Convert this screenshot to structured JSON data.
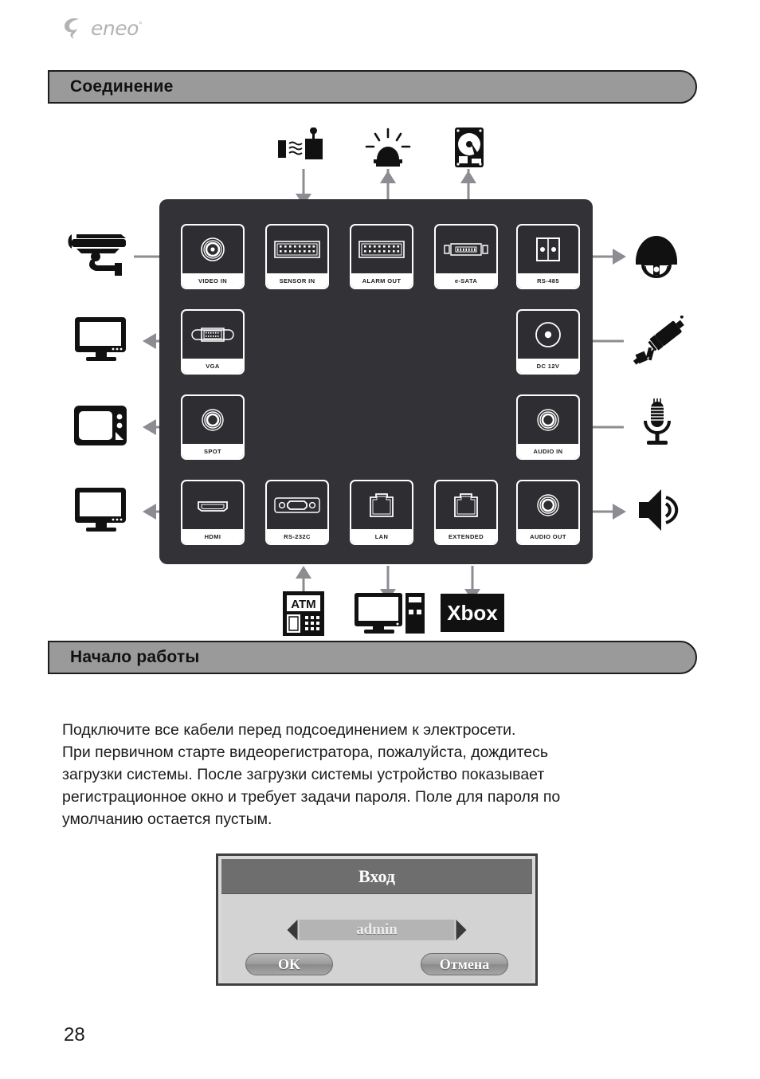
{
  "brand": {
    "name": "eneo",
    "trademark": "°",
    "logo_icon": "eneo-swirl-logo"
  },
  "sections": {
    "connection": {
      "title": "Соединение"
    },
    "getting_started": {
      "title": "Начало работы"
    }
  },
  "diagram": {
    "ports": {
      "video_in": {
        "label": "VIDEO IN",
        "icon": "bnc-connector-icon"
      },
      "sensor_in": {
        "label": "SENSOR IN",
        "icon": "terminal-block-icon"
      },
      "alarm_out": {
        "label": "ALARM OUT",
        "icon": "terminal-block-icon"
      },
      "esata": {
        "label": "e-SATA",
        "icon": "esata-connector-icon"
      },
      "rs485": {
        "label": "RS-485",
        "icon": "rs485-terminal-icon"
      },
      "vga": {
        "label": "VGA",
        "icon": "vga-connector-icon"
      },
      "dc12v": {
        "label": "DC 12V",
        "icon": "dc-jack-icon"
      },
      "spot": {
        "label": "SPOT",
        "icon": "rca-jack-icon"
      },
      "audio_in": {
        "label": "AUDIO IN",
        "icon": "rca-jack-icon"
      },
      "hdmi": {
        "label": "HDMI",
        "icon": "hdmi-connector-icon"
      },
      "rs232c": {
        "label": "RS-232C",
        "icon": "db9-connector-icon"
      },
      "lan": {
        "label": "LAN",
        "icon": "rj45-connector-icon"
      },
      "extended": {
        "label": "EXTENDED",
        "icon": "rj45-connector-icon"
      },
      "audio_out": {
        "label": "AUDIO OUT",
        "icon": "rca-jack-icon"
      }
    },
    "devices": {
      "camera": {
        "icon": "cctv-bullet-camera-icon"
      },
      "sensor": {
        "icon": "motion-sensor-icon"
      },
      "siren": {
        "icon": "alarm-siren-icon"
      },
      "hdd": {
        "icon": "hard-disk-drive-icon"
      },
      "ptz": {
        "icon": "ptz-dome-camera-icon"
      },
      "monitor_vga": {
        "icon": "lcd-monitor-icon"
      },
      "power_adapter": {
        "icon": "power-adapter-plug-icon"
      },
      "spot_monitor": {
        "icon": "crt-monitor-icon"
      },
      "microphone": {
        "icon": "microphone-icon"
      },
      "monitor_hdmi": {
        "icon": "lcd-monitor-icon"
      },
      "speaker": {
        "icon": "speaker-icon"
      },
      "atm": {
        "icon": "atm-machine-icon",
        "label": "ATM"
      },
      "pc": {
        "icon": "desktop-computer-icon"
      },
      "xbox": {
        "icon": "xbox-console-icon",
        "label": "Xbox"
      }
    }
  },
  "instructions": {
    "line1": "Подключите все кабели перед подсоединением к электросети.",
    "line2": "При первичном старте видеорегистратора, пожалуйста, дождитесь",
    "line3": "загрузки системы. После загрузки системы устройство показывает",
    "line4": "регистрационное окно и требует задачи пароля. Поле для пароля по",
    "line5": "умолчанию остается пустым."
  },
  "login_dialog": {
    "title": "Вход",
    "user_value": "admin",
    "prev_icon": "triangle-left-icon",
    "next_icon": "triangle-right-icon",
    "ok_label": "OK",
    "cancel_label": "Отмена"
  },
  "footer": {
    "page_number": "28"
  },
  "colors": {
    "bar_fill": "#9a9a9a",
    "panel": "#333337",
    "arrow": "#8c8c92",
    "dialog_title": "#6e6e6e",
    "dialog_body": "#d3d3d3"
  }
}
